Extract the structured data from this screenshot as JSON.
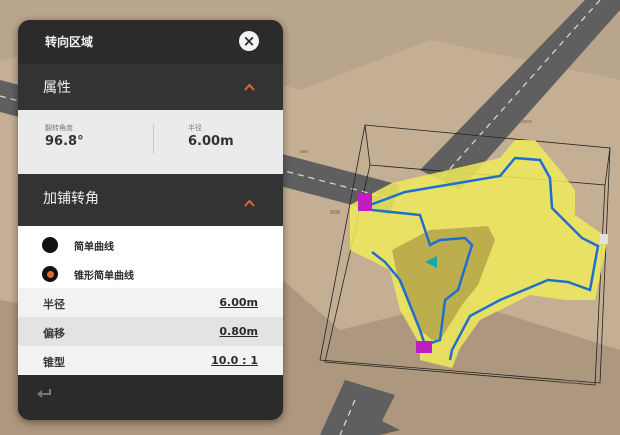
{
  "panel": {
    "title": "转向区域",
    "close_icon": "close-icon",
    "properties": {
      "header": "属性",
      "turn_angle": {
        "label": "翻转角度",
        "value": "96.8°"
      },
      "radius": {
        "label": "半径",
        "value": "6.00m"
      }
    },
    "curb_turn": {
      "header": "加铺转角",
      "options": [
        {
          "label": "简单曲线",
          "selected": false
        },
        {
          "label": "锥形简单曲线",
          "selected": true
        }
      ],
      "params": [
        {
          "label": "半径",
          "value": "6.00m"
        },
        {
          "label": "偏移",
          "value": "0.80m"
        },
        {
          "label": "锥型",
          "value": "10.0 : 1"
        }
      ]
    },
    "footer": {
      "undo_icon": "undo-icon"
    }
  },
  "colors": {
    "panel_bg": "#2b2b2b",
    "accent": "#e8643a",
    "region_fill": "#f0ea5a",
    "outline": "#1f6fd1",
    "road": "#5f5f5f"
  }
}
